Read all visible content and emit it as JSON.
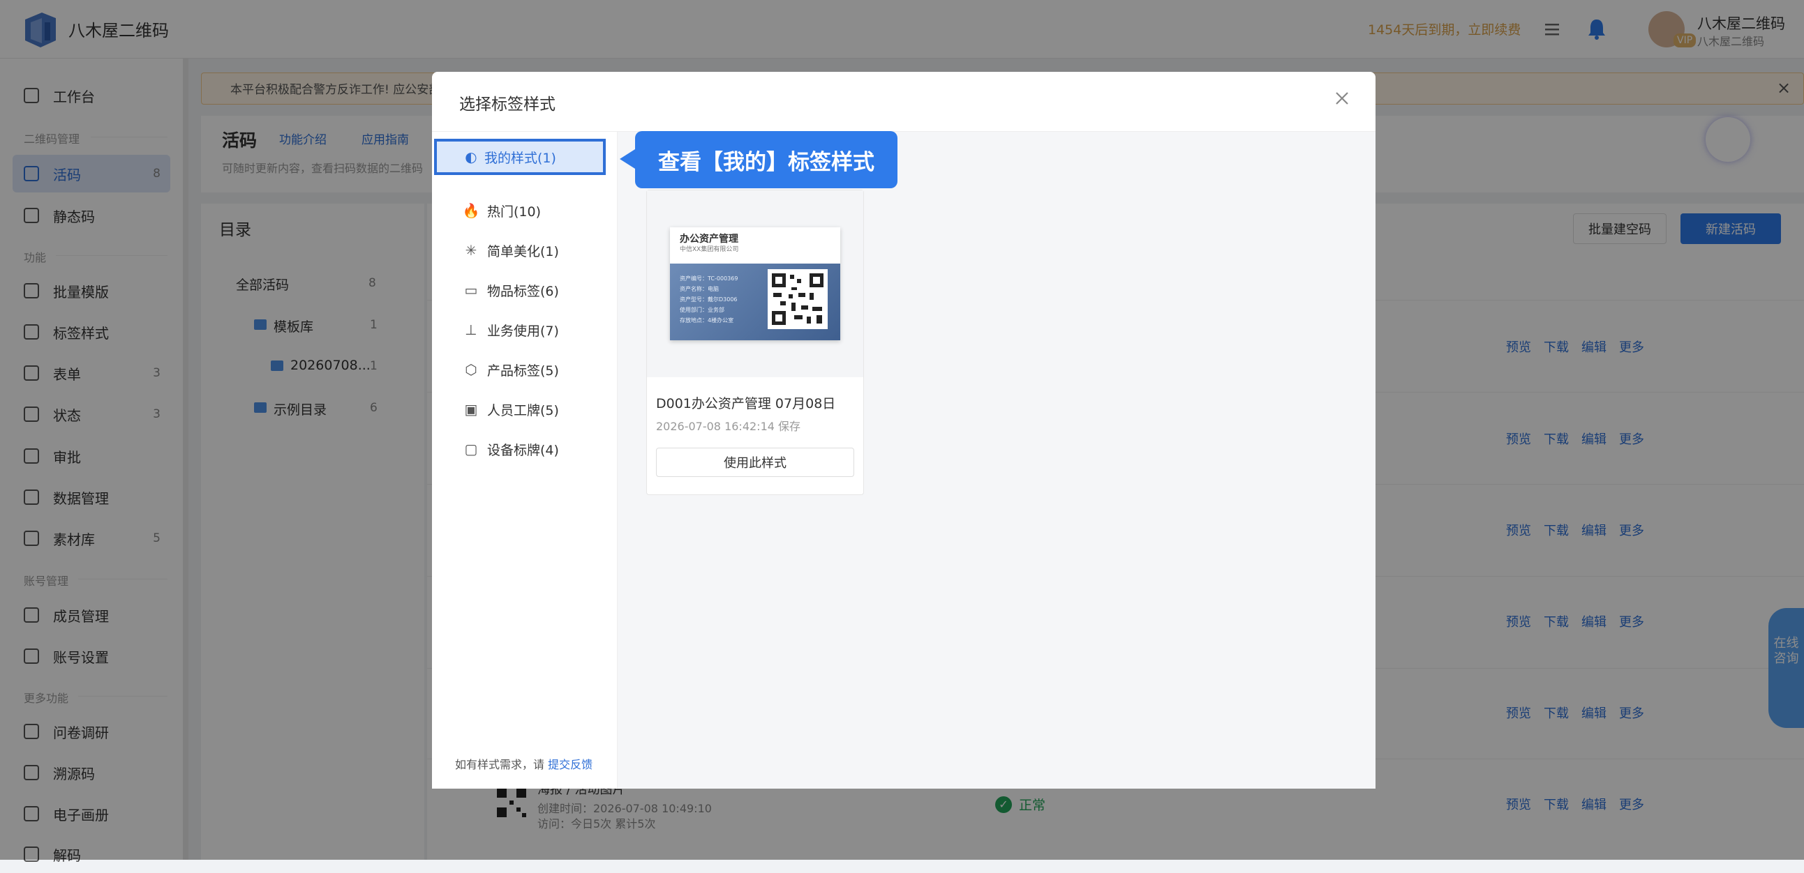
{
  "app": {
    "title": "八木屋二维码",
    "expire_text": "1454天后到期，立即续费",
    "user_name": "八木屋二维码",
    "user_sub": "八木屋二维码",
    "vip": "VIP"
  },
  "sidebar": {
    "items": [
      {
        "label": "工作台",
        "count": ""
      },
      {
        "label": "活码",
        "count": "8"
      },
      {
        "label": "静态码",
        "count": ""
      },
      {
        "label": "批量模版",
        "count": ""
      },
      {
        "label": "标签样式",
        "count": ""
      },
      {
        "label": "表单",
        "count": "3"
      },
      {
        "label": "状态",
        "count": "3"
      },
      {
        "label": "审批",
        "count": ""
      },
      {
        "label": "数据管理",
        "count": ""
      },
      {
        "label": "素材库",
        "count": "5"
      },
      {
        "label": "成员管理",
        "count": ""
      },
      {
        "label": "账号设置",
        "count": ""
      },
      {
        "label": "问卷调研",
        "count": ""
      },
      {
        "label": "溯源码",
        "count": ""
      },
      {
        "label": "电子画册",
        "count": ""
      },
      {
        "label": "解码",
        "count": ""
      }
    ],
    "sections": [
      "二维码管理",
      "功能",
      "账号管理",
      "更多功能"
    ]
  },
  "notice": {
    "text": "本平台积极配合警方反诈工作! 应公安部"
  },
  "page": {
    "title": "活码",
    "func_intro": "功能介绍",
    "app_guide": "应用指南",
    "sub": "可随时更新内容，查看扫码数据的二维码"
  },
  "directory": {
    "title": "目录",
    "items": [
      {
        "label": "全部活码",
        "count": "8"
      },
      {
        "label": "模板库",
        "count": "1"
      },
      {
        "label": "20260708...",
        "count": "1"
      },
      {
        "label": "示例目录",
        "count": "6"
      }
    ]
  },
  "list": {
    "batch_btn": "批量建空码",
    "new_btn": "新建活码",
    "actions": [
      "预览",
      "下载",
      "编辑",
      "更多"
    ],
    "last_row": {
      "title": "海报 / 活动图片",
      "time": "创建时间：2026-07-08 10:49:10",
      "visits": "访问：今日5次 累计5次",
      "status": "正常"
    }
  },
  "consult": "在线咨询",
  "modal": {
    "title": "选择标签样式",
    "categories": [
      {
        "label": "我的样式(1)",
        "icon": "palette-icon"
      },
      {
        "label": "热门(10)",
        "icon": "fire-icon"
      },
      {
        "label": "简单美化(1)",
        "icon": "sparkle-icon"
      },
      {
        "label": "物品标签(6)",
        "icon": "box-icon"
      },
      {
        "label": "业务使用(7)",
        "icon": "stamp-icon"
      },
      {
        "label": "产品标签(5)",
        "icon": "cube-icon"
      },
      {
        "label": "人员工牌(5)",
        "icon": "badge-icon"
      },
      {
        "label": "设备标牌(4)",
        "icon": "monitor-icon"
      }
    ],
    "feedback_prefix": "如有样式需求，请",
    "feedback_link": "提交反馈",
    "tooltip": "查看【我的】标签样式",
    "card": {
      "label_title": "办公资产管理",
      "label_sub": "中信XX集团有限公司",
      "label_lines": [
        "资产编号：TC-000369",
        "资产名称：电脑",
        "资产型号：戴尔D3006",
        "使用部门：业务部",
        "存放地点：4楼办公室"
      ],
      "name": "D001办公资产管理 07月08日",
      "date": "2026-07-08 16:42:14 保存",
      "use_btn": "使用此样式"
    }
  }
}
